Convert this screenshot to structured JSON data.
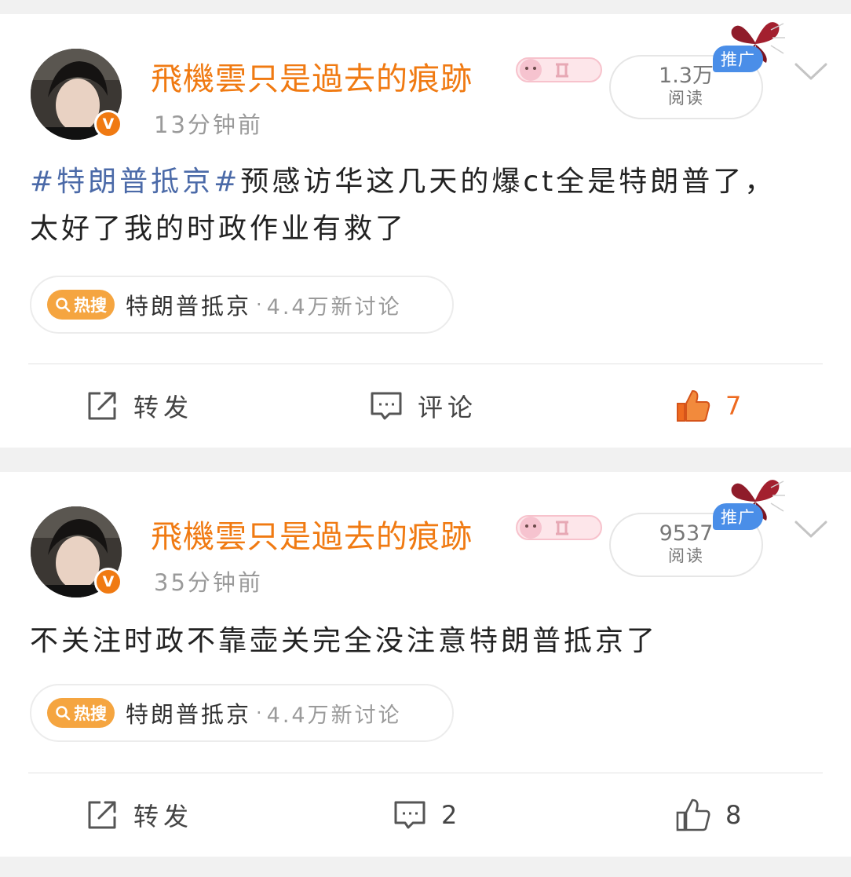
{
  "posts": [
    {
      "username": "飛機雲只是過去的痕跡",
      "verified_badge": "V",
      "timestamp": "13分钟前",
      "reads": {
        "value": "1.3万",
        "label": "阅读"
      },
      "promo_label": "推广",
      "content_hashtag": "#特朗普抵京#",
      "content_text": "预感访华这几天的爆ct全是特朗普了，太好了我的时政作业有救了",
      "hot_search": {
        "badge": "热搜",
        "topic": "特朗普抵京",
        "separator": "·",
        "count": "4.4万新讨论"
      },
      "actions": {
        "repost": "转发",
        "comment": "评论",
        "like": "7",
        "liked": true
      }
    },
    {
      "username": "飛機雲只是過去的痕跡",
      "verified_badge": "V",
      "timestamp": "35分钟前",
      "reads": {
        "value": "9537",
        "label": "阅读"
      },
      "promo_label": "推广",
      "content_text": "不关注时政不靠壶关完全没注意特朗普抵京了",
      "hot_search": {
        "badge": "热搜",
        "topic": "特朗普抵京",
        "separator": "·",
        "count": "4.4万新讨论"
      },
      "actions": {
        "repost": "转发",
        "comment": "2",
        "like": "8",
        "liked": false
      }
    }
  ],
  "colors": {
    "username": "#f07a12",
    "hashtag": "#4b6aa8",
    "liked": "#ee6a1f",
    "promo": "#4a8ee8",
    "hot_badge": "#f5a540"
  }
}
